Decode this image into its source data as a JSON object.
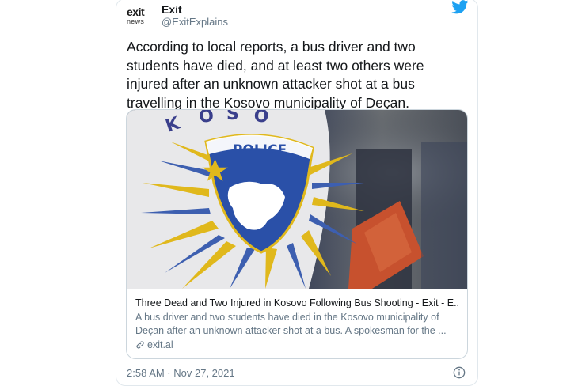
{
  "tweet": {
    "avatar": {
      "line1": "exit",
      "line2": "news"
    },
    "author_name": "Exit",
    "handle": "@ExitExplains",
    "text": "According to local reports, a bus driver and two students have died, and at least two others were injured after an unknown attacker shot at a bus travelling in the Kosovo municipality of Deçan.",
    "timestamp": "2:58 AM · Nov 27, 2021",
    "link_card": {
      "image_text": "POLICE",
      "title": "Three Dead and Two Injured in Kosovo Following Bus Shooting - Exit - E...",
      "description": "A bus driver and two students have died in the Kosovo municipality of Deçan after an unknown attacker shot at a bus. A spokesman for the ...",
      "domain": "exit.al"
    }
  },
  "colors": {
    "twitter_blue": "#1da1f2",
    "text_primary": "#14171a",
    "text_secondary": "#657786",
    "border": "#ccd6dd"
  },
  "icons": {
    "brand": "twitter-bird-icon",
    "link": "link-icon",
    "info": "info-icon"
  }
}
